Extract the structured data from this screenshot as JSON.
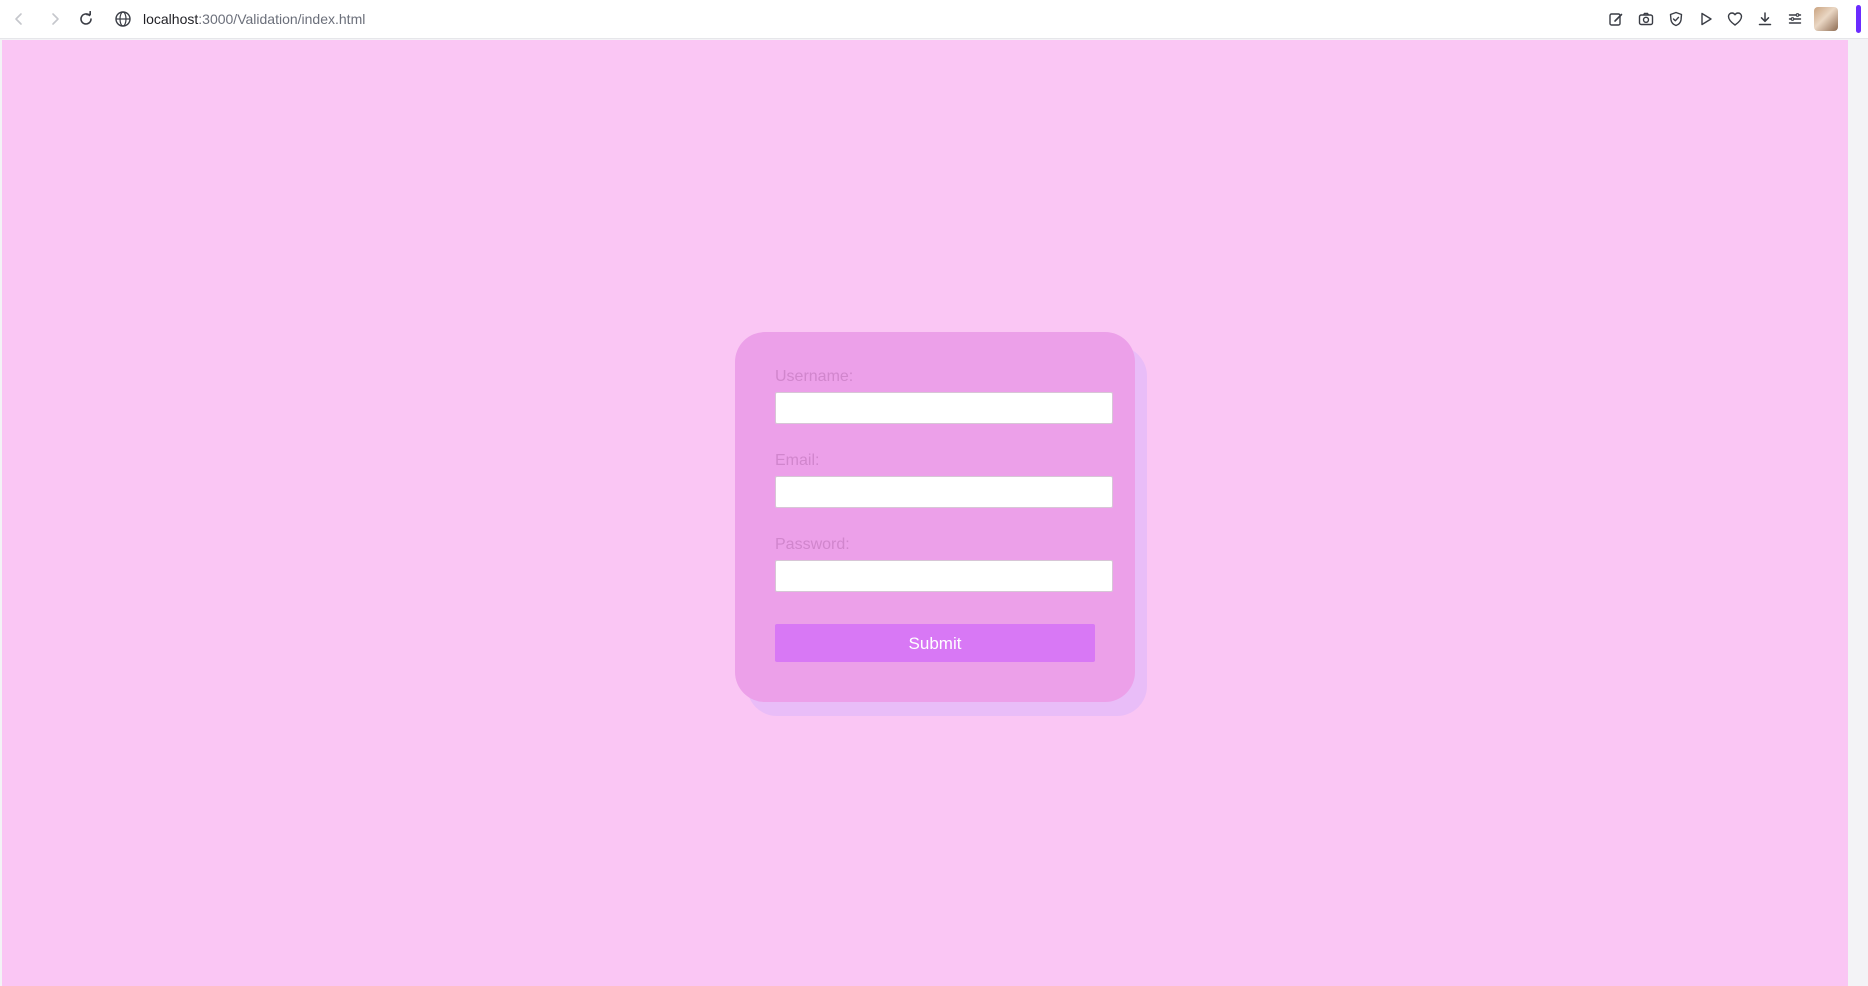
{
  "browser": {
    "url_host": "localhost",
    "url_path": ":3000/Validation/index.html",
    "icons": {
      "back": "arrow-left",
      "forward": "arrow-right",
      "reload": "reload",
      "site": "globe",
      "edit": "edit",
      "screenshot": "camera",
      "shield": "shield-check",
      "play": "play",
      "favorite": "heart",
      "download": "download",
      "menu": "menu"
    }
  },
  "page": {
    "background_color": "#fac6f4",
    "form": {
      "card_color": "#eca0e9",
      "username_label": "Username:",
      "username_value": "",
      "email_label": "Email:",
      "email_value": "",
      "password_label": "Password:",
      "password_value": "",
      "submit_label": "Submit",
      "submit_color": "#d878f5"
    }
  }
}
